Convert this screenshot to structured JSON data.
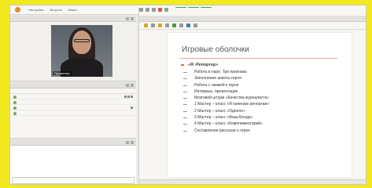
{
  "topbar": {
    "menu": [
      "Настройки",
      "Встреча",
      "Макет"
    ]
  },
  "video": {
    "presenter_name": "Презентер"
  },
  "document": {
    "title": "Игровые оболочки",
    "list_heading": "«Я -Репортер»",
    "items": [
      "Работа в паре. Три признака",
      "Заполнение анкеты героя",
      "Работа с гаммой к героя",
      "Интервью, презентация",
      "Мозговой штурм «Качества журналиста»",
      "1 Мастер – класс «Я начинаю репортаж»",
      "2 Мастер – класс «Одеяло»",
      "3 Мастер – класс «Фаза Бонда»",
      "4 Мастер – класс «Комплиментарий»",
      "Составление рассказа о герое"
    ]
  },
  "colors": {
    "background": "#f2e91f",
    "accent": "#e06f2c",
    "rule": "#f2a48e"
  }
}
